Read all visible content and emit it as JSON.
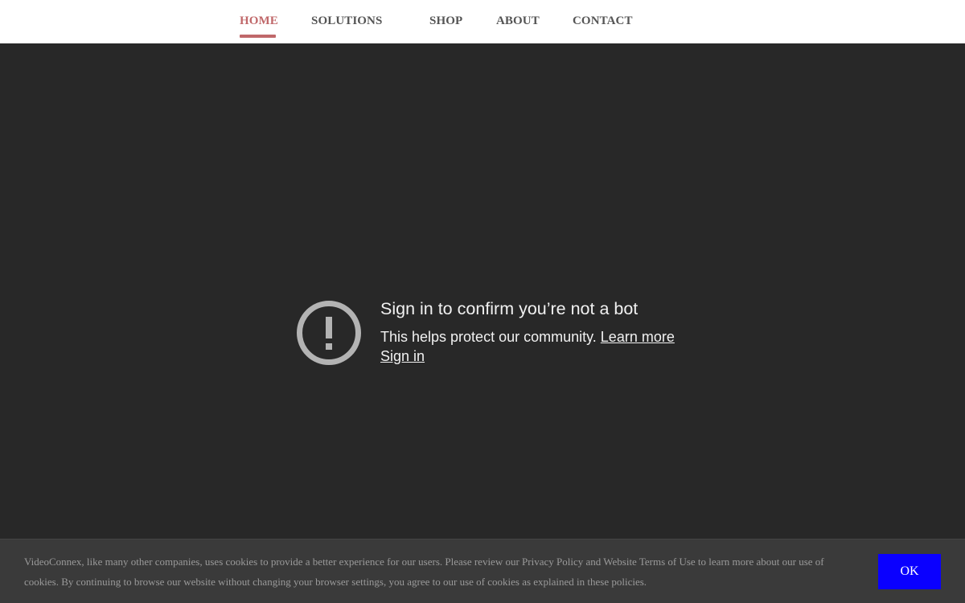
{
  "nav": {
    "items": [
      {
        "label": "HOME",
        "active": true
      },
      {
        "label": "SOLUTIONS",
        "active": false
      },
      {
        "label": "SHOP",
        "active": false
      },
      {
        "label": "ABOUT",
        "active": false
      },
      {
        "label": "CONTACT",
        "active": false
      }
    ],
    "active_color": "#c0686a",
    "text_color": "#555555"
  },
  "bot_check": {
    "icon": "alert-circle-icon",
    "title": "Sign in to confirm you’re not a bot",
    "description": "This helps protect our community.",
    "learn_more_label": "Learn more",
    "sign_in_label": "Sign in"
  },
  "cookie_banner": {
    "text": "VideoConnex, like many other companies, uses cookies to provide a better experience for our users. Please review our Privacy Policy and Website Terms of Use to learn more about our use of cookies. By continuing to browse our website without changing your browser settings, you agree to our use of cookies as explained in these policies.",
    "ok_label": "OK",
    "ok_color": "#0a00ff"
  }
}
